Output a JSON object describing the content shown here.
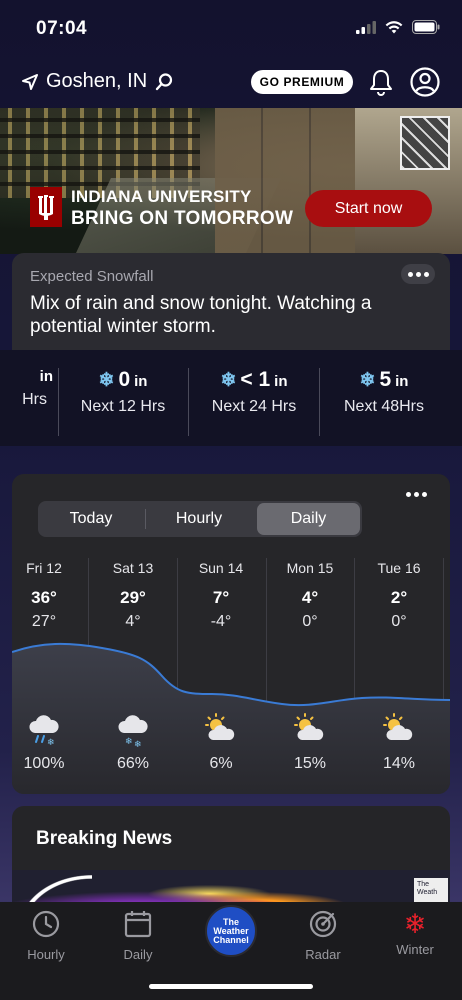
{
  "status_bar": {
    "time": "07:04"
  },
  "header": {
    "location": "Goshen, IN",
    "premium_label": "GO PREMIUM"
  },
  "ad": {
    "line1": "INDIANA UNIVERSITY",
    "line2": "BRING ON TOMORROW",
    "cta": "Start now",
    "brand_color": "#990000"
  },
  "snowfall": {
    "title": "Expected Snowfall",
    "message": "Mix of rain and snow tonight. Watching a potential winter storm.",
    "items": [
      {
        "amount": "",
        "unit": "in",
        "label": "Hrs"
      },
      {
        "amount": "0",
        "unit": "in",
        "label": "Next 12 Hrs"
      },
      {
        "amount": "< 1",
        "unit": "in",
        "label": "Next 24 Hrs"
      },
      {
        "amount": "5",
        "unit": "in",
        "label": "Next 48Hrs"
      }
    ]
  },
  "forecast": {
    "tabs": [
      "Today",
      "Hourly",
      "Daily"
    ],
    "active_tab": "Daily",
    "days": [
      {
        "name": "Fri 12",
        "hi": "36°",
        "lo": "27°",
        "icon": "rain-snow-icon",
        "precip": "100%"
      },
      {
        "name": "Sat 13",
        "hi": "29°",
        "lo": "4°",
        "icon": "snow-cloud-icon",
        "precip": "66%"
      },
      {
        "name": "Sun 14",
        "hi": "7°",
        "lo": "-4°",
        "icon": "partly-cloudy-icon",
        "precip": "6%"
      },
      {
        "name": "Mon 15",
        "hi": "4°",
        "lo": "0°",
        "icon": "partly-cloudy-icon",
        "precip": "15%"
      },
      {
        "name": "Tue 16",
        "hi": "2°",
        "lo": "0°",
        "icon": "partly-cloudy-icon",
        "precip": "14%"
      }
    ],
    "line_color": "#3a7bd5"
  },
  "news": {
    "title": "Breaking News",
    "badge_text": "The Weath"
  },
  "tab_bar": {
    "items": [
      {
        "label": "Hourly",
        "icon": "clock-icon"
      },
      {
        "label": "Daily",
        "icon": "calendar-icon"
      },
      {
        "label": "",
        "icon": "weather-channel-logo"
      },
      {
        "label": "Radar",
        "icon": "radar-icon"
      },
      {
        "label": "Winter",
        "icon": "snowflake-icon"
      }
    ],
    "logo_text": "The Weather Channel",
    "winter_color": "#e8212b"
  }
}
